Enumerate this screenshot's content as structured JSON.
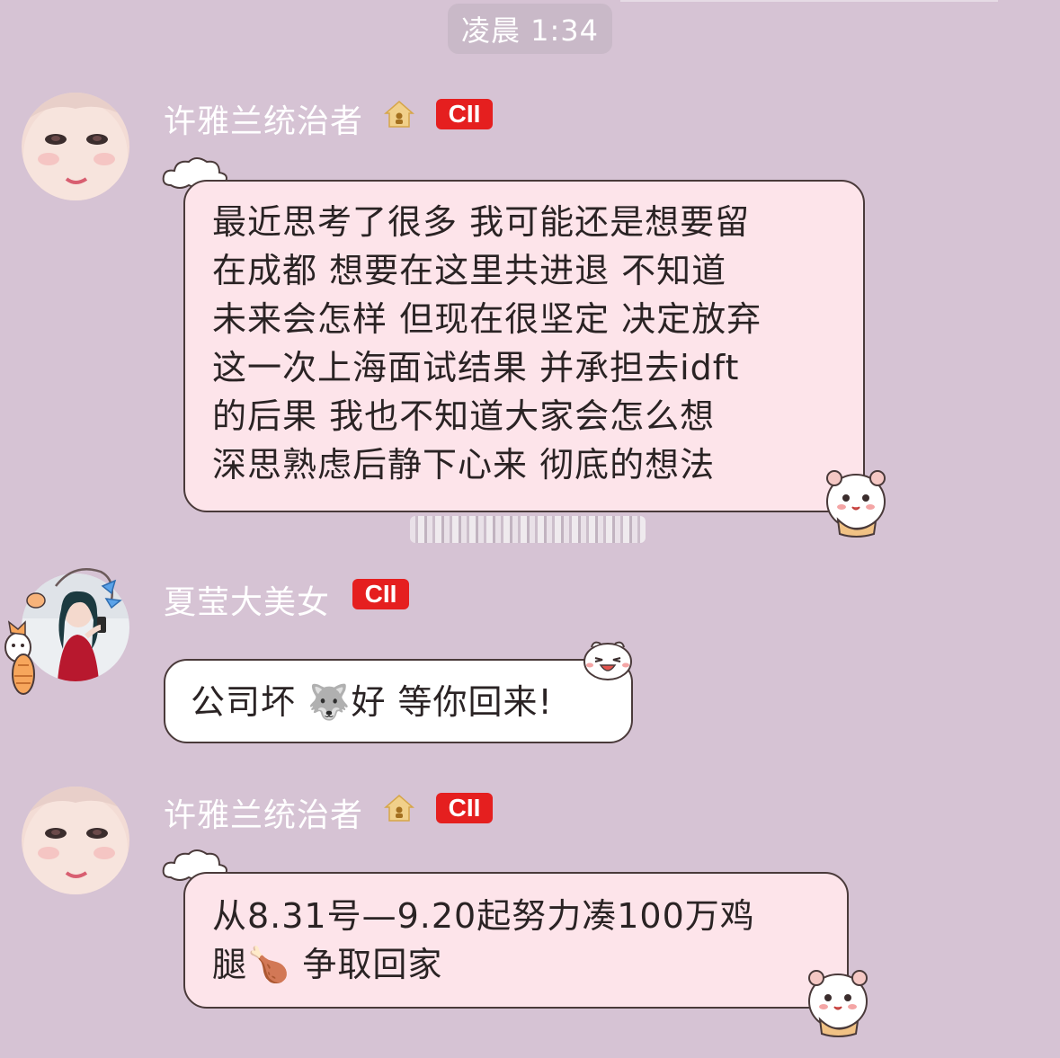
{
  "chat": {
    "timestamp": "凌晨 1:34",
    "messages": [
      {
        "sender": "许雅兰统治者",
        "badge": "CII",
        "sender_icon": "house-icon",
        "avatar_icon": "avatar-photo",
        "bubble_style": "pink",
        "lines": [
          "最近思考了很多 我可能还是想要留",
          "在成都 想要在这里共进退  不知道",
          "未来会怎样 但现在很坚定 决定放弃",
          "这一次上海面试结果  并承担去idft",
          "的后果  我也不知道大家会怎么想",
          "深思熟虑后静下心来 彻底的想法"
        ]
      },
      {
        "sender": "夏莹大美女",
        "badge": "CII",
        "avatar_icon": "avatar-photo",
        "bubble_style": "white",
        "line_before_emoji": "公司坏",
        "emoji": "🐺",
        "line_after_emoji": "好 等你回来!"
      },
      {
        "sender": "许雅兰统治者",
        "badge": "CII",
        "sender_icon": "house-icon",
        "avatar_icon": "avatar-photo",
        "bubble_style": "pink",
        "line1": "从8.31号—9.20起努力凑100万鸡",
        "line2_before": "腿",
        "emoji": "🍗",
        "line2_after": " 争取回家"
      }
    ]
  },
  "colors": {
    "background": "#d6c3d4",
    "pink_bubble": "#fde4ea",
    "white_bubble": "#ffffff",
    "badge": "#e51f1f",
    "name_text": "#ffffff",
    "time_pill": "#c9b9c8"
  }
}
